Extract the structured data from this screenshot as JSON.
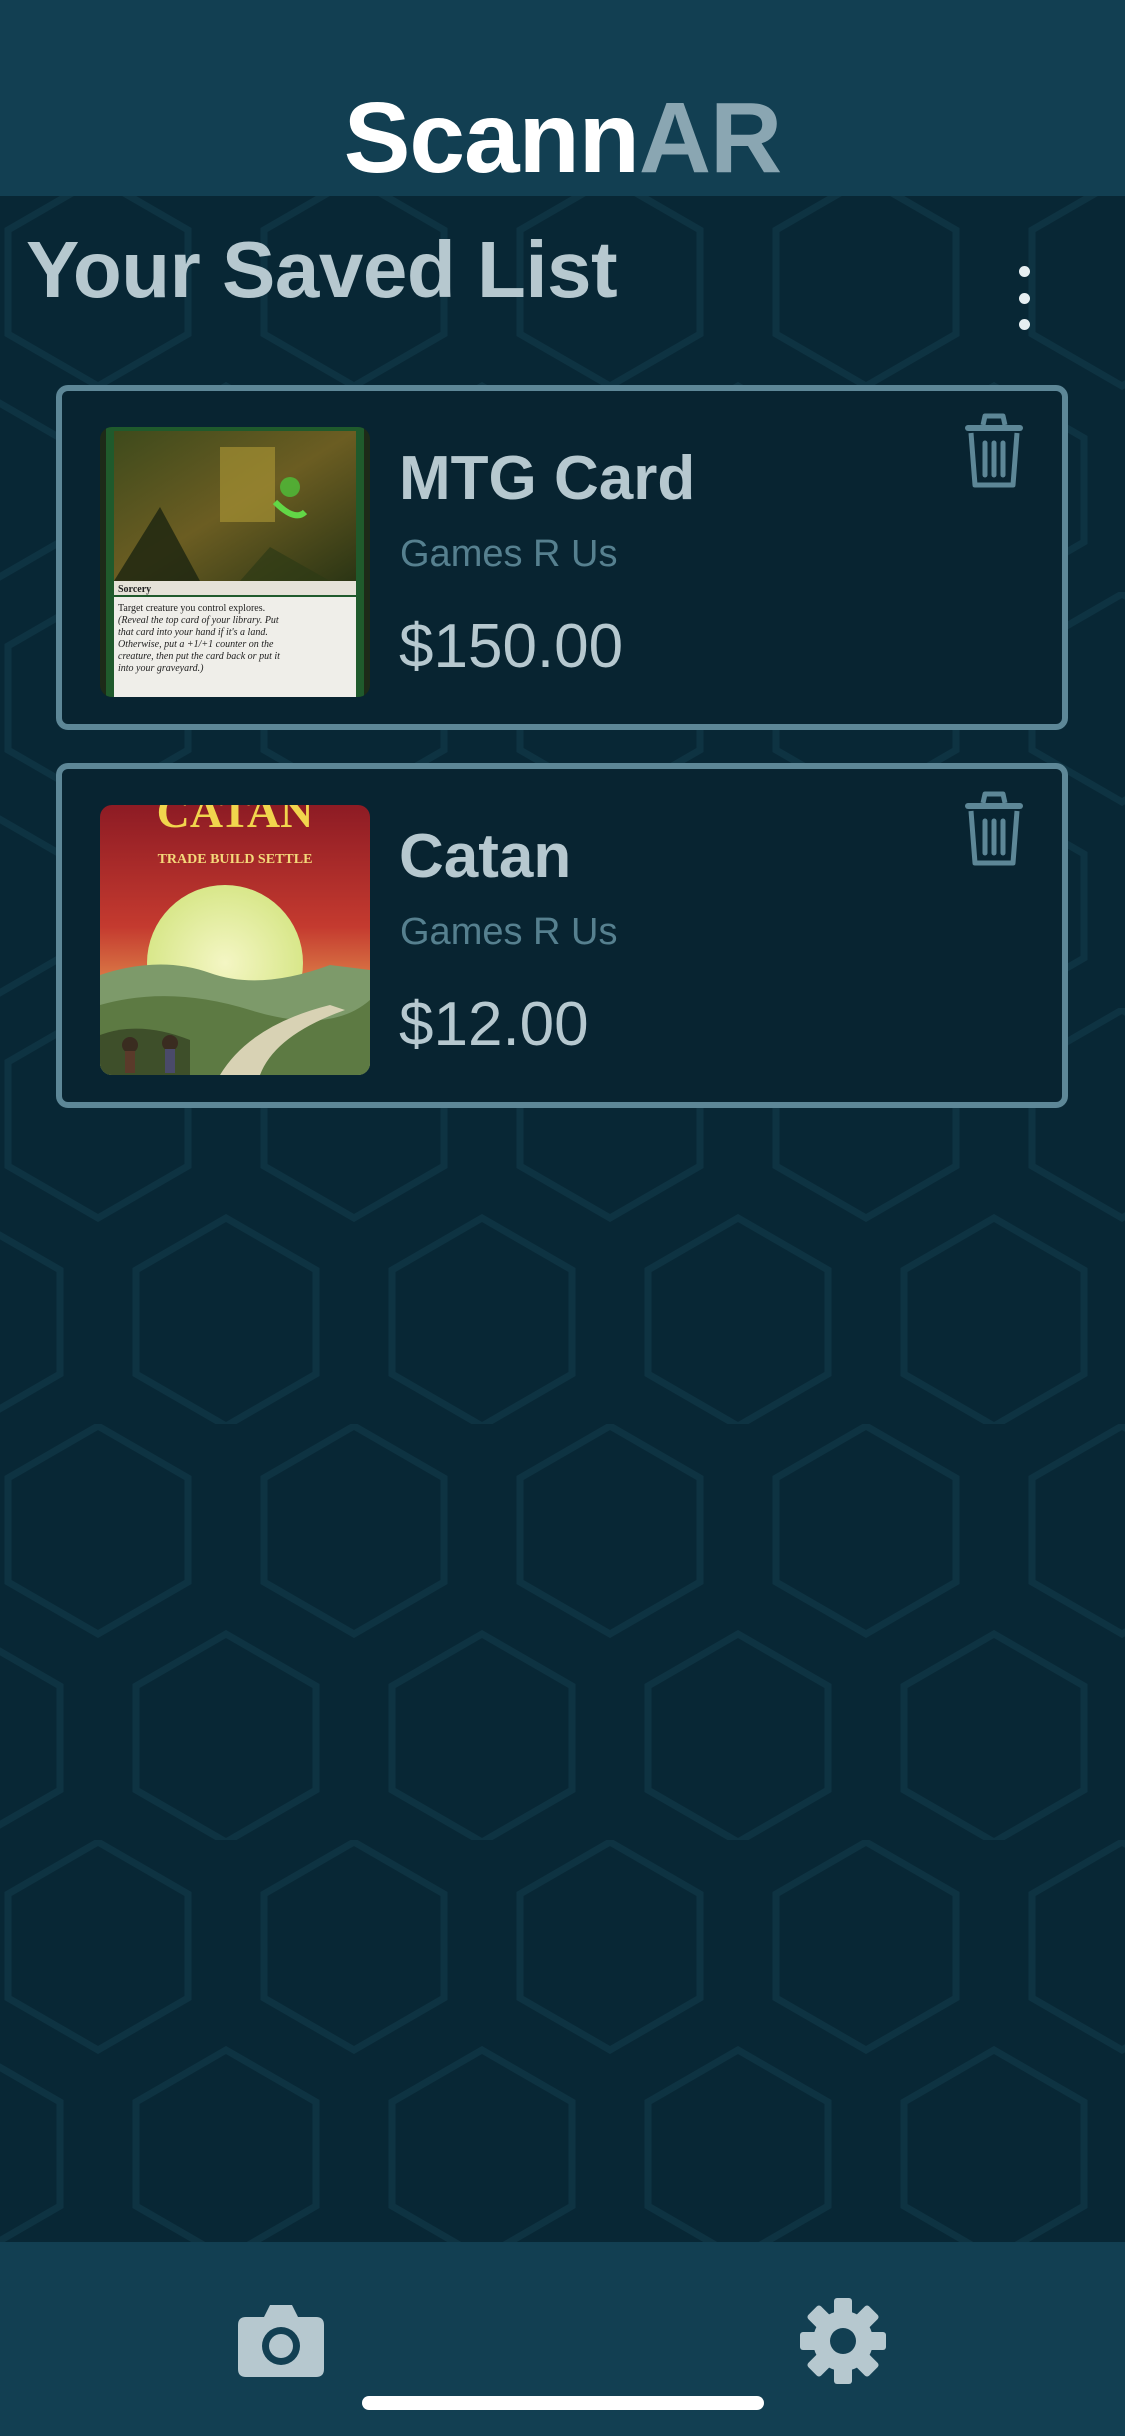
{
  "app": {
    "logo_part1": "Scann",
    "logo_part2": "AR"
  },
  "page": {
    "title": "Your Saved List",
    "menu_icon": "more-vertical-icon"
  },
  "items": [
    {
      "name": "MTG Card",
      "store": "Games R Us",
      "price": "$150.00",
      "image": "mtg-card-photo",
      "image_text": {
        "type_line": "Sorcery",
        "rules_line1": "Target creature you control explores.",
        "rules_line2": "(Reveal the top card of your library. Put",
        "rules_line3": "that card into your hand if it's a land.",
        "rules_line4": "Otherwise, put a +1/+1 counter on the",
        "rules_line5": "creature, then put the card back or put it",
        "rules_line6": "into your graveyard.)"
      },
      "delete_icon": "trash-icon"
    },
    {
      "name": "Catan",
      "store": "Games R Us",
      "price": "$12.00",
      "image": "catan-box-photo",
      "image_text": {
        "brand": "CATAN",
        "tagline": "TRADE BUILD SETTLE"
      },
      "delete_icon": "trash-icon"
    }
  ],
  "tabbar": {
    "left_icon": "camera-icon",
    "right_icon": "settings-gear-icon"
  },
  "colors": {
    "background": "#082735",
    "header": "#123f52",
    "card_border": "#5d8797",
    "text_primary": "#b6c8cf",
    "text_secondary": "#56808f",
    "logo_accent": "#8aa6b2"
  }
}
